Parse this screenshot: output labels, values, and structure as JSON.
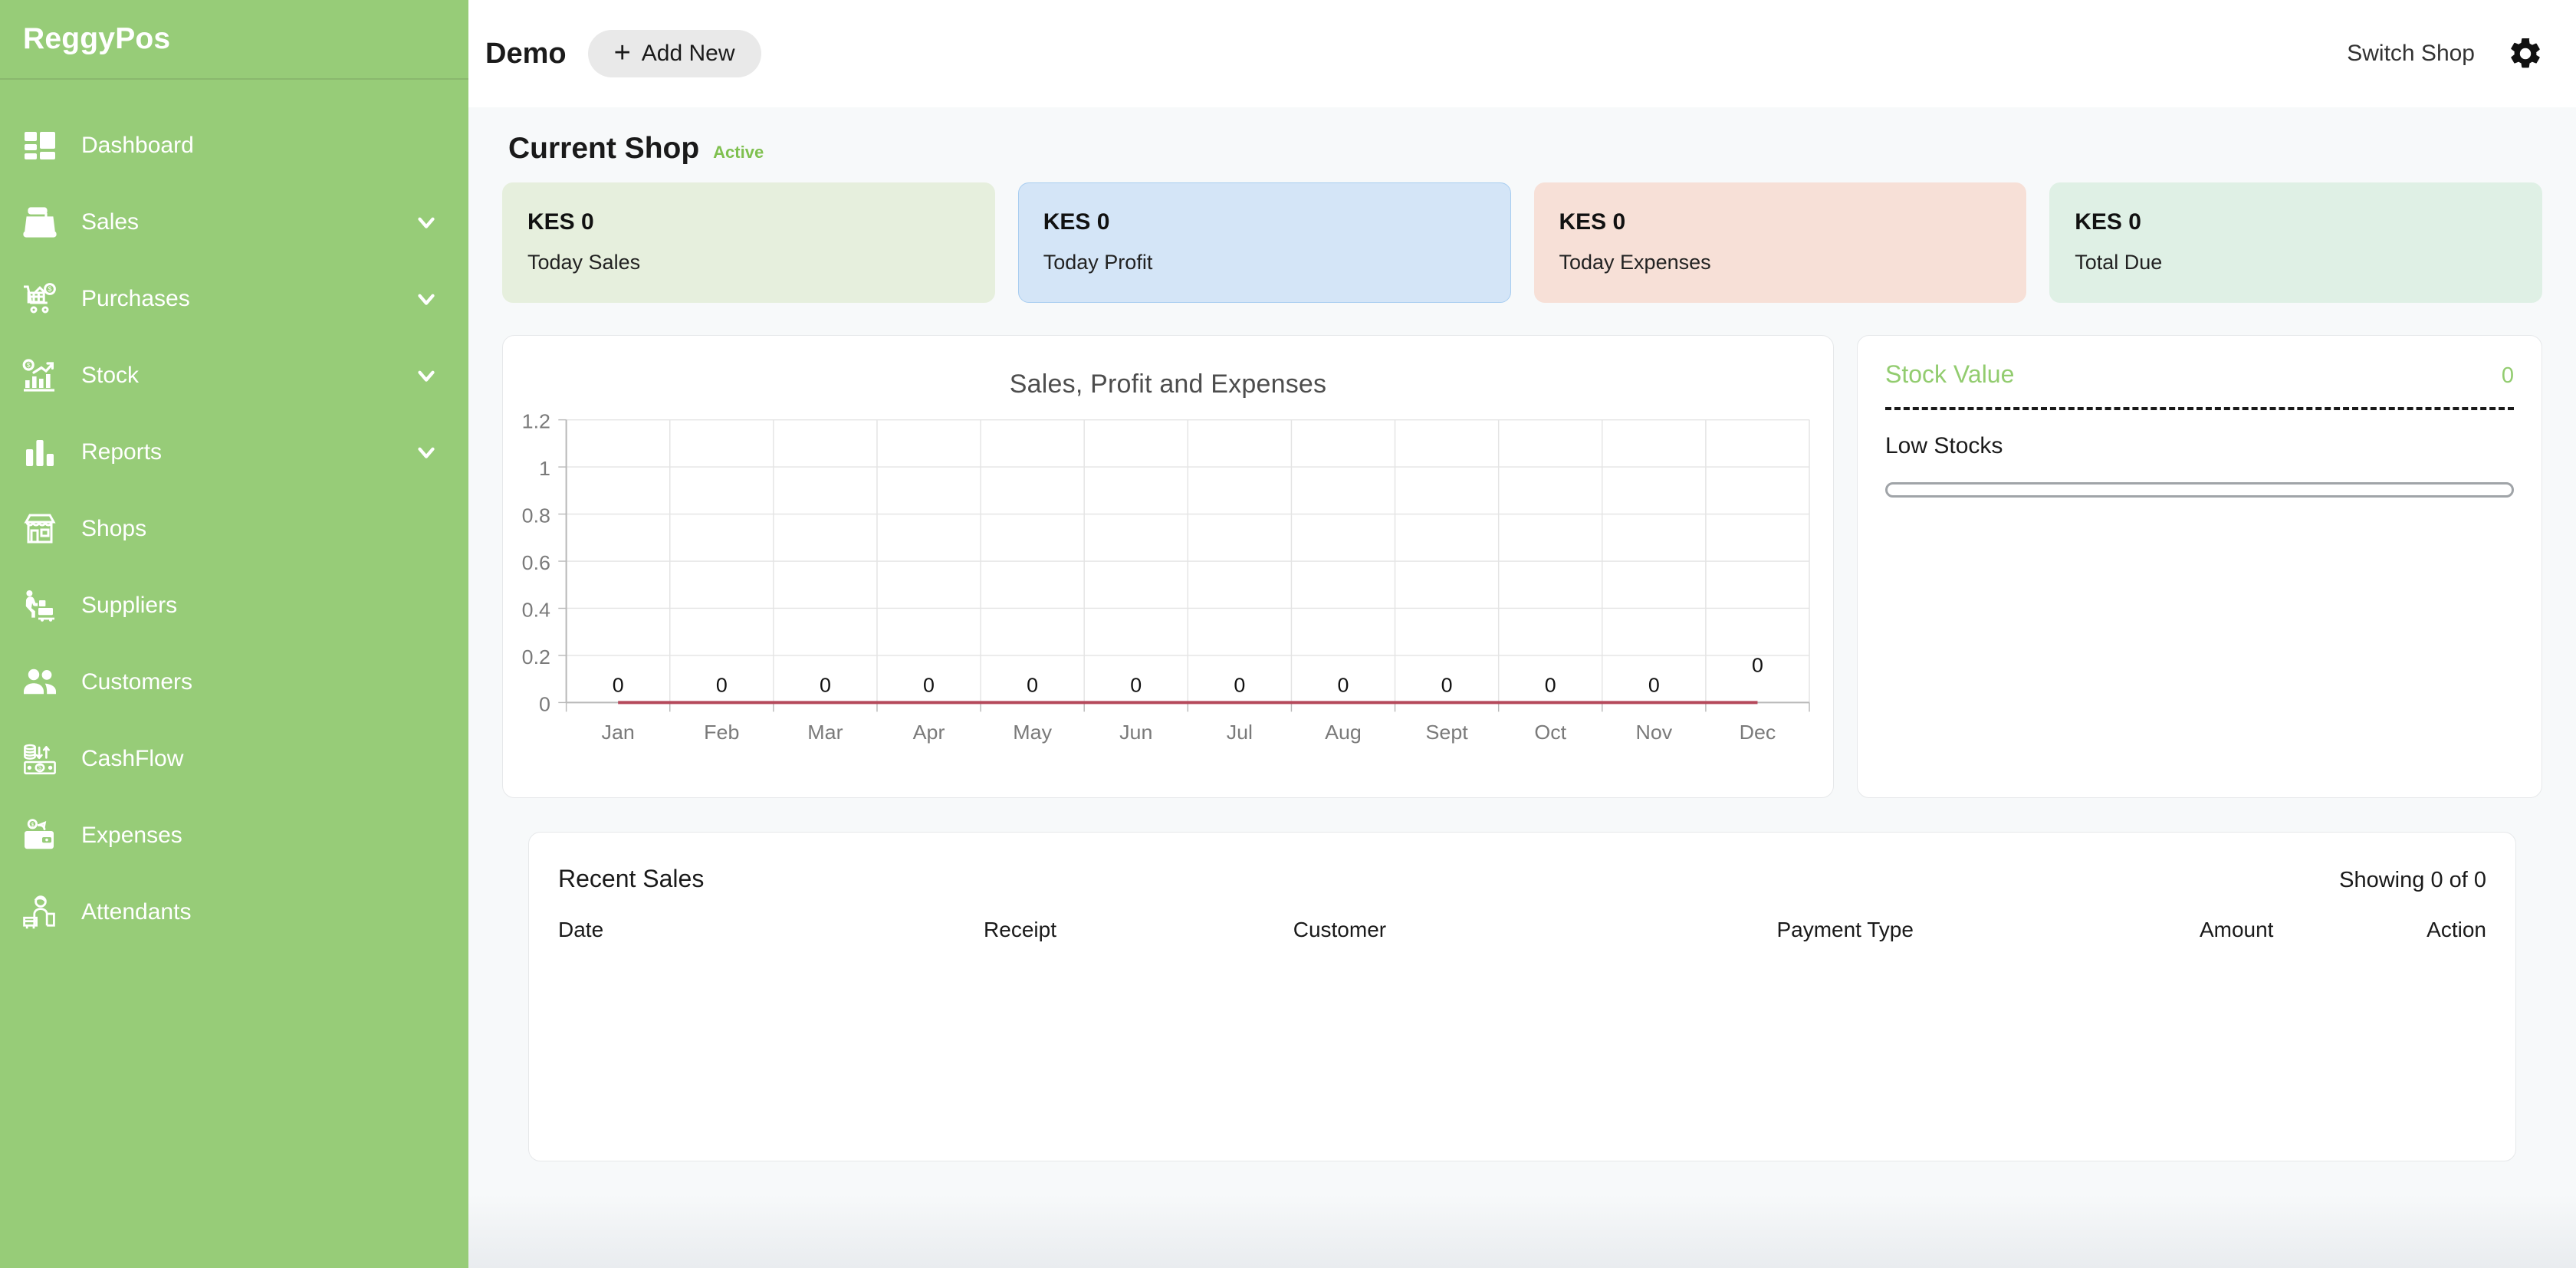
{
  "brand": {
    "name": "ReggyPos"
  },
  "sidebar": {
    "items": [
      {
        "label": "Dashboard",
        "icon": "dashboard-icon",
        "expandable": false
      },
      {
        "label": "Sales",
        "icon": "cash-register-icon",
        "expandable": true
      },
      {
        "label": "Purchases",
        "icon": "shopping-cart-icon",
        "expandable": true
      },
      {
        "label": "Stock",
        "icon": "growth-chart-icon",
        "expandable": true
      },
      {
        "label": "Reports",
        "icon": "bar-chart-icon",
        "expandable": true
      },
      {
        "label": "Shops",
        "icon": "storefront-icon",
        "expandable": false
      },
      {
        "label": "Suppliers",
        "icon": "delivery-icon",
        "expandable": false
      },
      {
        "label": "Customers",
        "icon": "people-icon",
        "expandable": false
      },
      {
        "label": "CashFlow",
        "icon": "cashflow-icon",
        "expandable": false
      },
      {
        "label": "Expenses",
        "icon": "wallet-icon",
        "expandable": false
      },
      {
        "label": "Attendants",
        "icon": "attendant-icon",
        "expandable": false
      }
    ]
  },
  "topbar": {
    "title": "Demo",
    "add_new_label": "Add New",
    "add_new_plus": "+",
    "switch_shop_label": "Switch Shop",
    "settings_icon": "gear-icon"
  },
  "current_shop": {
    "title": "Current Shop",
    "status": "Active",
    "status_color": "#7fc04f"
  },
  "stats": [
    {
      "value": "KES 0",
      "label": "Today Sales",
      "bg": "#e6efdd",
      "border": "#e6efdd"
    },
    {
      "value": "KES 0",
      "label": "Today Profit",
      "bg": "#d4e5f7",
      "border": "#a8cdf0"
    },
    {
      "value": "KES 0",
      "label": "Today Expenses",
      "bg": "#f7e0d7",
      "border": "#f7e0d7"
    },
    {
      "value": "KES 0",
      "label": "Total Due",
      "bg": "#dff0e5",
      "border": "#dff0e5"
    }
  ],
  "stock_panel": {
    "title": "Stock Value",
    "value": "0",
    "low_stocks_label": "Low Stocks",
    "low_stocks_percent": 0,
    "accent_color": "#92cc6f"
  },
  "recent_sales": {
    "title": "Recent Sales",
    "showing": "Showing 0 of 0",
    "columns": [
      "Date",
      "Receipt",
      "Customer",
      "Payment Type",
      "Amount",
      "Action"
    ],
    "rows": []
  },
  "chart_data": {
    "type": "line",
    "title": "Sales, Profit and Expenses",
    "xlabel": "",
    "ylabel": "",
    "categories": [
      "Jan",
      "Feb",
      "Mar",
      "Apr",
      "May",
      "Jun",
      "Jul",
      "Aug",
      "Sept",
      "Oct",
      "Nov",
      "Dec"
    ],
    "series": [
      {
        "name": "Sales",
        "values": [
          0,
          0,
          0,
          0,
          0,
          0,
          0,
          0,
          0,
          0,
          0,
          0
        ],
        "color": "#b5495b"
      },
      {
        "name": "Profit",
        "values": [
          0,
          0,
          0,
          0,
          0,
          0,
          0,
          0,
          0,
          0,
          0,
          0
        ],
        "color": "#9aa0a6"
      },
      {
        "name": "Expenses",
        "values": [
          0,
          0,
          0,
          0,
          0,
          0,
          0,
          0,
          0,
          0,
          0,
          0
        ],
        "color": "#9aa0a6"
      }
    ],
    "point_labels": [
      "0",
      "0",
      "0",
      "0",
      "0",
      "0",
      "0",
      "0",
      "0",
      "0",
      "0",
      "0"
    ],
    "yticks": [
      "1.2",
      "1",
      "0.8",
      "0.6",
      "0.4",
      "0.2",
      "0"
    ],
    "ylim": [
      0,
      1.2
    ],
    "grid": true,
    "legend": "none"
  }
}
